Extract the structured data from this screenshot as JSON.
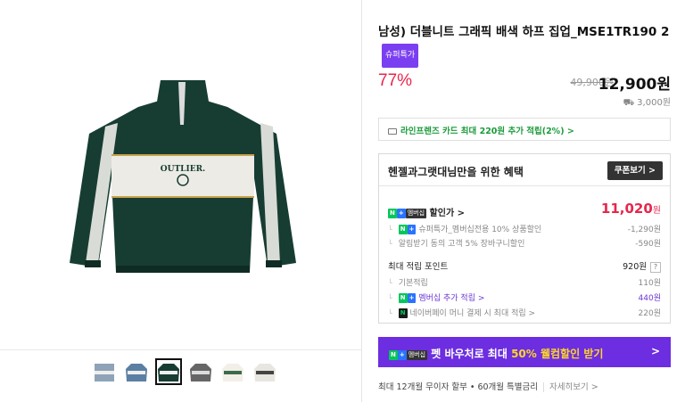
{
  "product": {
    "title": "남성) 더블니트 그래픽 배색 하프 집업_MSE1TR190 2",
    "badge": "슈퍼특가",
    "discount_rate": "77%",
    "original_price": "49,900원",
    "price": "12,900원",
    "shipping": "3,000원"
  },
  "card_promo": "라인프렌즈 카드 최대 220원 추가 적립(2%) >",
  "benefit": {
    "title": "헨젤과그랫대님만을 위한 혜택",
    "coupon_label": "쿠폰보기 >",
    "member_badge": "멤버십",
    "discount_label": "할인가 >",
    "discount_price": "11,020",
    "discount_unit": "원",
    "rows": [
      {
        "label": "슈퍼특가_멤버십전용 10% 상품할인",
        "value": "-1,290원"
      },
      {
        "label": "알림받기 동의 고객 5% 장바구니할인",
        "value": "-590원"
      }
    ],
    "points_label": "최대 적립 포인트",
    "points_value": "920원",
    "points_help": "?",
    "point_rows": [
      {
        "label": "기본적립",
        "value": "110원"
      },
      {
        "label": "멤버십 추가 적립 >",
        "value": "440원"
      },
      {
        "label": "네이버페이 머니 결제 시 최대 적립 >",
        "value": "220원"
      }
    ]
  },
  "banner": {
    "badge": "멤버십",
    "text_prefix": "펫 바우처로 최대",
    "text_highlight": "50% 웰컴할인 받기",
    "arrow": ">"
  },
  "installment": {
    "text": "최대 12개월 무이자 할부 • 60개월 특별금리",
    "link": "자세히보기 >"
  },
  "colors": {
    "accent": "#e8264c",
    "naver": "#03c75a",
    "purple": "#6c2ee0"
  },
  "icons": [
    "card-icon",
    "shipping-icon",
    "naver-n-icon",
    "naver-plus-icon",
    "arrow-right-icon"
  ]
}
